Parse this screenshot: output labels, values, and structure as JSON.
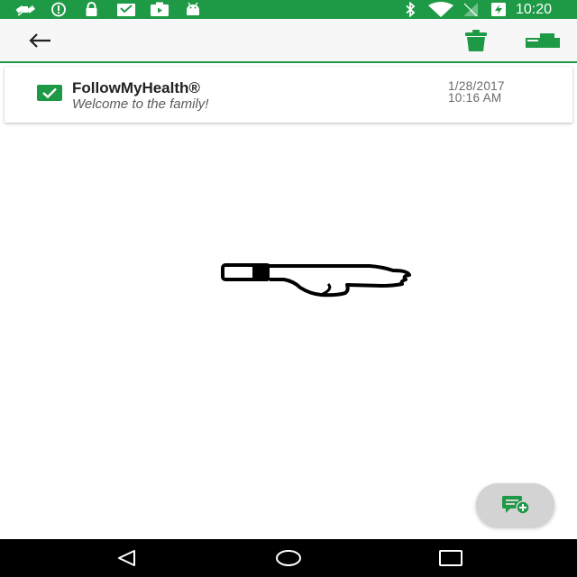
{
  "status_bar": {
    "time": "10:20",
    "left_icons": [
      "satellite-icon",
      "info-icon",
      "lock-icon",
      "inbox-icon",
      "video-icon",
      "android-icon"
    ],
    "right_icons": [
      "bluetooth-icon",
      "wifi-icon",
      "no-signal-icon",
      "battery-charging-icon"
    ]
  },
  "toolbar": {
    "back_icon": "arrow-left-icon",
    "delete_icon": "trash-icon",
    "move_icon": "move-to-folder-icon"
  },
  "message": {
    "title": "FollowMyHealth®",
    "subtitle": "Welcome to the family!",
    "date": "1/28/2017",
    "time": "10:16 AM",
    "checked": true
  },
  "content": {
    "graphic": "thumbs-down-icon"
  },
  "fab": {
    "icon": "new-message-icon"
  },
  "nav_bar": {
    "buttons": [
      "back-triangle-icon",
      "home-circle-icon",
      "recents-square-icon"
    ]
  },
  "colors": {
    "brand_green": "#1e9a46",
    "toolbar_bg": "#f7f7f7",
    "fab_bg": "#d3d3d3"
  }
}
